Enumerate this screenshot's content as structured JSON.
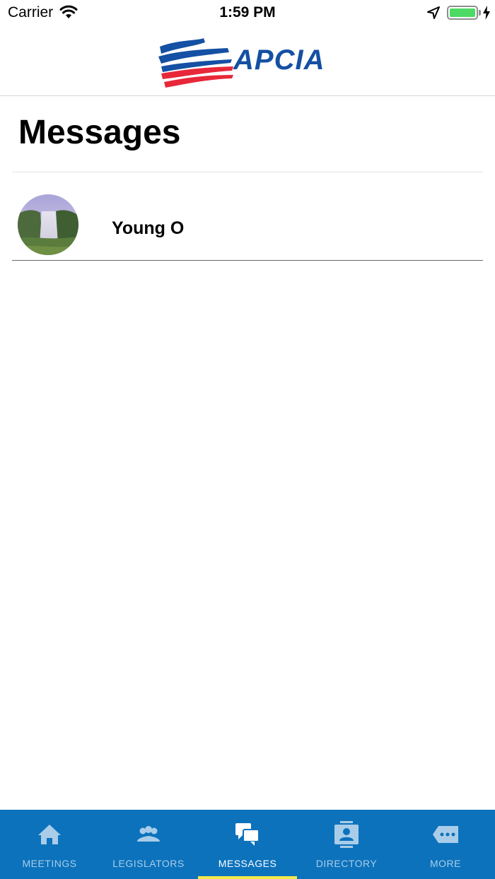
{
  "status_bar": {
    "carrier": "Carrier",
    "time": "1:59 PM",
    "battery_level": 1.0,
    "battery_color": "#4cd964"
  },
  "header": {
    "logo_text": "APCIA",
    "logo_colors": {
      "blue": "#1450a3",
      "red": "#e8283a"
    }
  },
  "page": {
    "title": "Messages"
  },
  "messages": [
    {
      "name": "Young O",
      "avatar": "waterfall-photo"
    }
  ],
  "tab_bar": {
    "background": "#0c72bc",
    "active_indicator": "#f5e94a",
    "tabs": [
      {
        "label": "MEETINGS",
        "icon": "home-icon",
        "active": false
      },
      {
        "label": "LEGISLATORS",
        "icon": "people-icon",
        "active": false
      },
      {
        "label": "MESSAGES",
        "icon": "chat-bubbles-icon",
        "active": true
      },
      {
        "label": "DIRECTORY",
        "icon": "contact-card-icon",
        "active": false
      },
      {
        "label": "MORE",
        "icon": "more-tag-icon",
        "active": false
      }
    ]
  }
}
